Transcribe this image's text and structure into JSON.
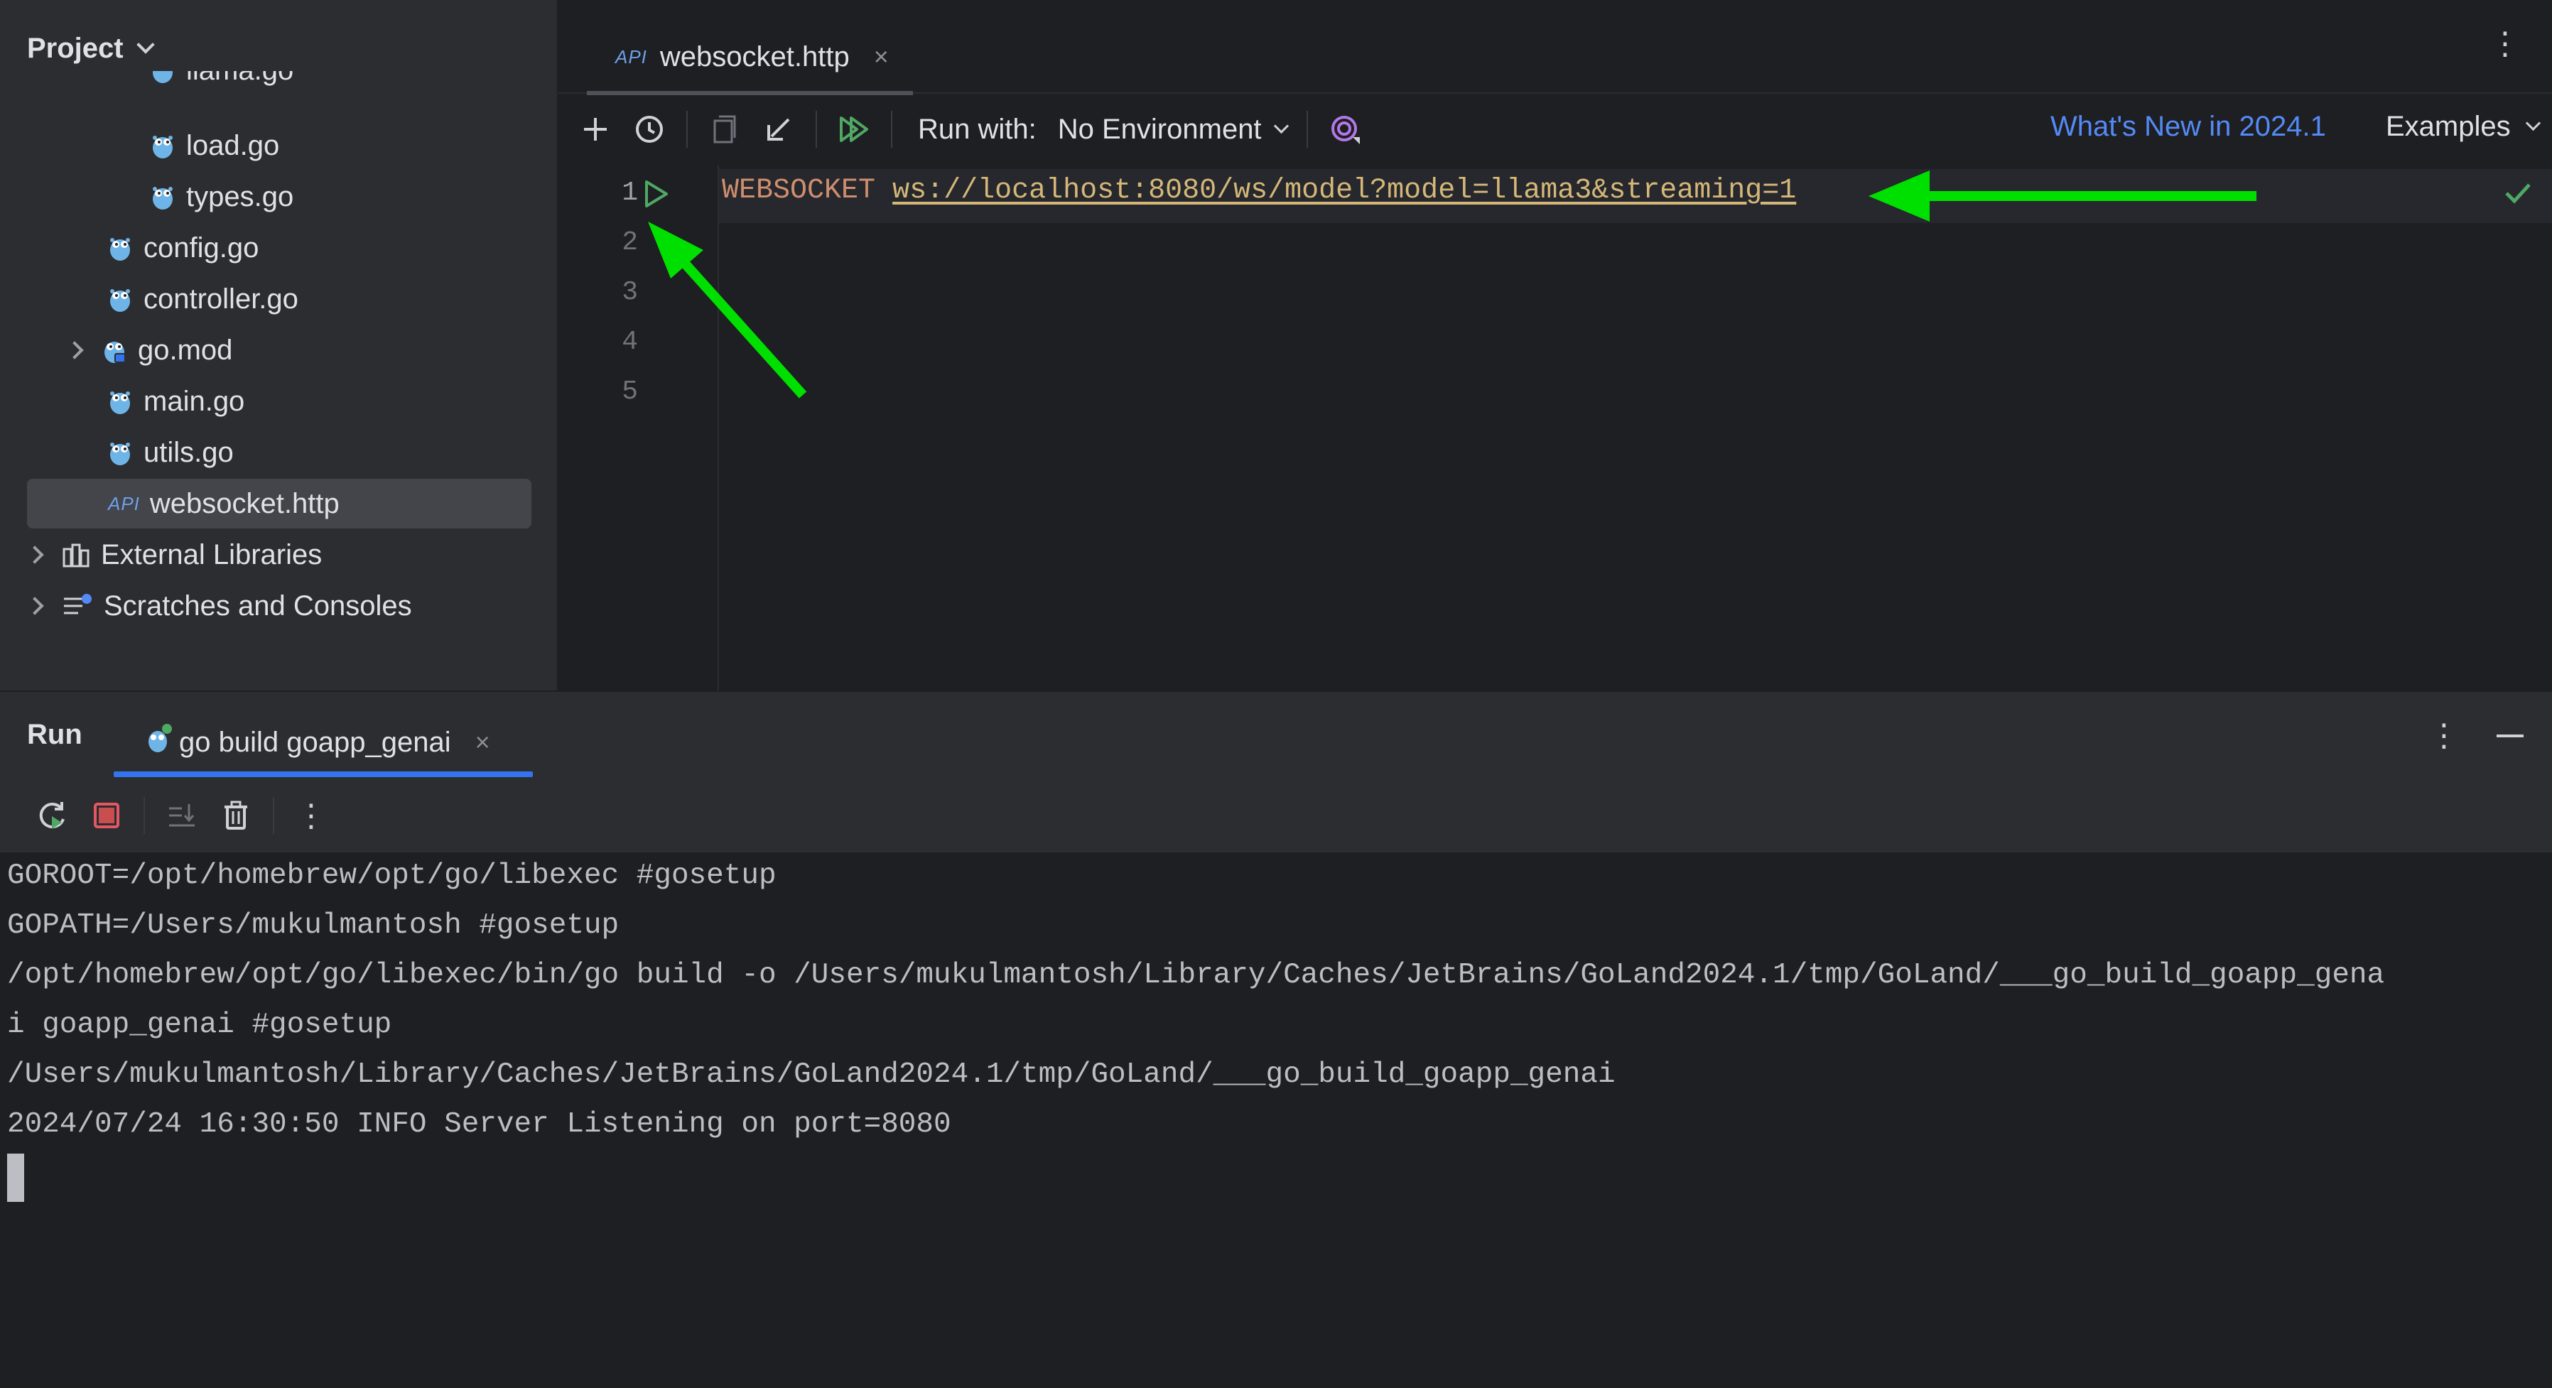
{
  "project_panel": {
    "title": "Project",
    "tree": [
      {
        "label": "llama.go",
        "icon": "go-file-icon"
      },
      {
        "label": "load.go",
        "icon": "go-file-icon"
      },
      {
        "label": "types.go",
        "icon": "go-file-icon"
      },
      {
        "label": "config.go",
        "icon": "go-file-icon"
      },
      {
        "label": "controller.go",
        "icon": "go-file-icon"
      },
      {
        "label": "go.mod",
        "icon": "go-module-icon"
      },
      {
        "label": "main.go",
        "icon": "go-file-icon"
      },
      {
        "label": "utils.go",
        "icon": "go-file-icon"
      },
      {
        "label": "websocket.http",
        "icon": "api-icon",
        "api_tag": "API",
        "selected": true
      },
      {
        "label": "External Libraries",
        "icon": "libraries-icon"
      },
      {
        "label": "Scratches and Consoles",
        "icon": "scratches-icon"
      }
    ]
  },
  "editor": {
    "tab": {
      "api_tag": "API",
      "label": "websocket.http",
      "close": "×"
    },
    "toolbar": {
      "run_with_label": "Run with:",
      "environment": "No Environment",
      "whats_new": "What's New in 2024.1",
      "examples": "Examples"
    },
    "line_numbers": [
      "1",
      "2",
      "3",
      "4",
      "5"
    ],
    "code": {
      "keyword": "WEBSOCKET",
      "url": "ws://localhost:8080/ws/model?model=llama3&streaming=1"
    }
  },
  "run_panel": {
    "title": "Run",
    "tab_label": "go build goapp_genai",
    "tab_close": "×",
    "console_lines": [
      "GOROOT=/opt/homebrew/opt/go/libexec #gosetup",
      "GOPATH=/Users/mukulmantosh #gosetup",
      "/opt/homebrew/opt/go/libexec/bin/go build -o /Users/mukulmantosh/Library/Caches/JetBrains/GoLand2024.1/tmp/GoLand/___go_build_goapp_gena",
      "i goapp_genai #gosetup",
      "/Users/mukulmantosh/Library/Caches/JetBrains/GoLand2024.1/tmp/GoLand/___go_build_goapp_genai",
      "2024/07/24 16:30:50 INFO Server Listening on port=8080"
    ]
  },
  "colors": {
    "background": "#1e1f22",
    "panel": "#2b2d30",
    "accent_blue": "#3574f0",
    "link_blue": "#548af7",
    "keyword_orange": "#cf8e6d",
    "url_yellow": "#d5b778",
    "annotation_green": "#00e000"
  }
}
